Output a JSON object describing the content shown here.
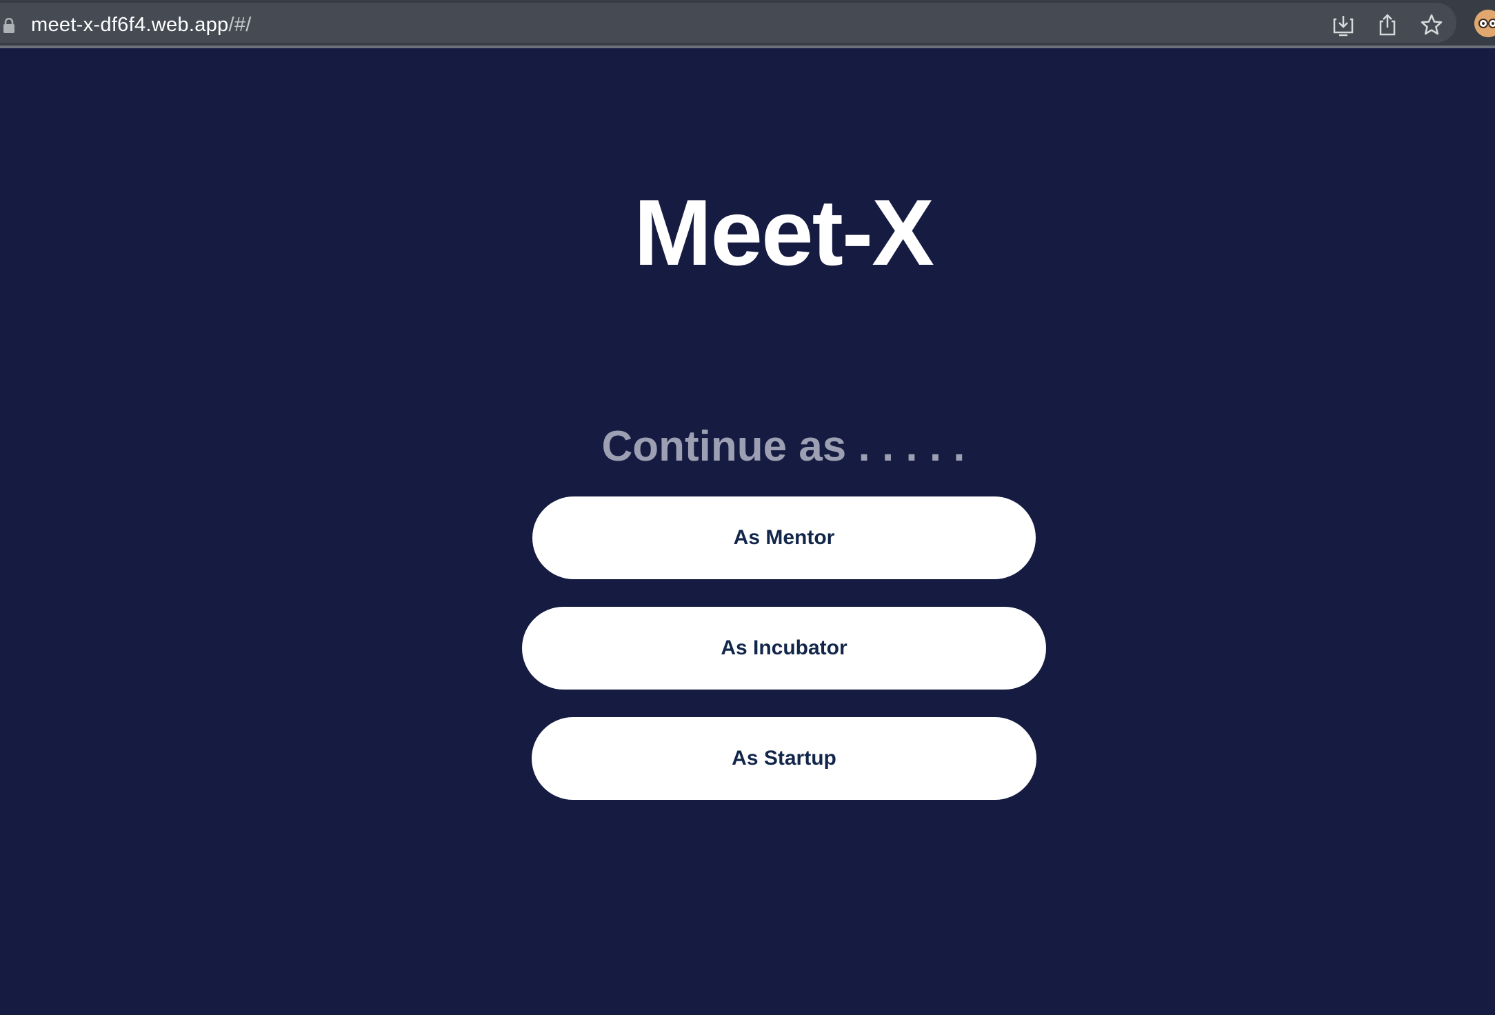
{
  "browser": {
    "url_host": "meet-x-df6f4.web.app",
    "url_path": "/#/",
    "icons": [
      "lock-icon",
      "install-app-icon",
      "share-icon",
      "bookmark-star-icon",
      "profile-avatar"
    ]
  },
  "page": {
    "title": "Meet-X",
    "prompt": "Continue as . . . . .",
    "buttons": {
      "mentor": "As Mentor",
      "incubator": "As Incubator",
      "startup": "As Startup"
    }
  },
  "colors": {
    "background": "#151b41",
    "button_bg": "#ffffff",
    "button_text": "#12264a",
    "prompt_text": "#9da0b3",
    "title_text": "#ffffff"
  }
}
